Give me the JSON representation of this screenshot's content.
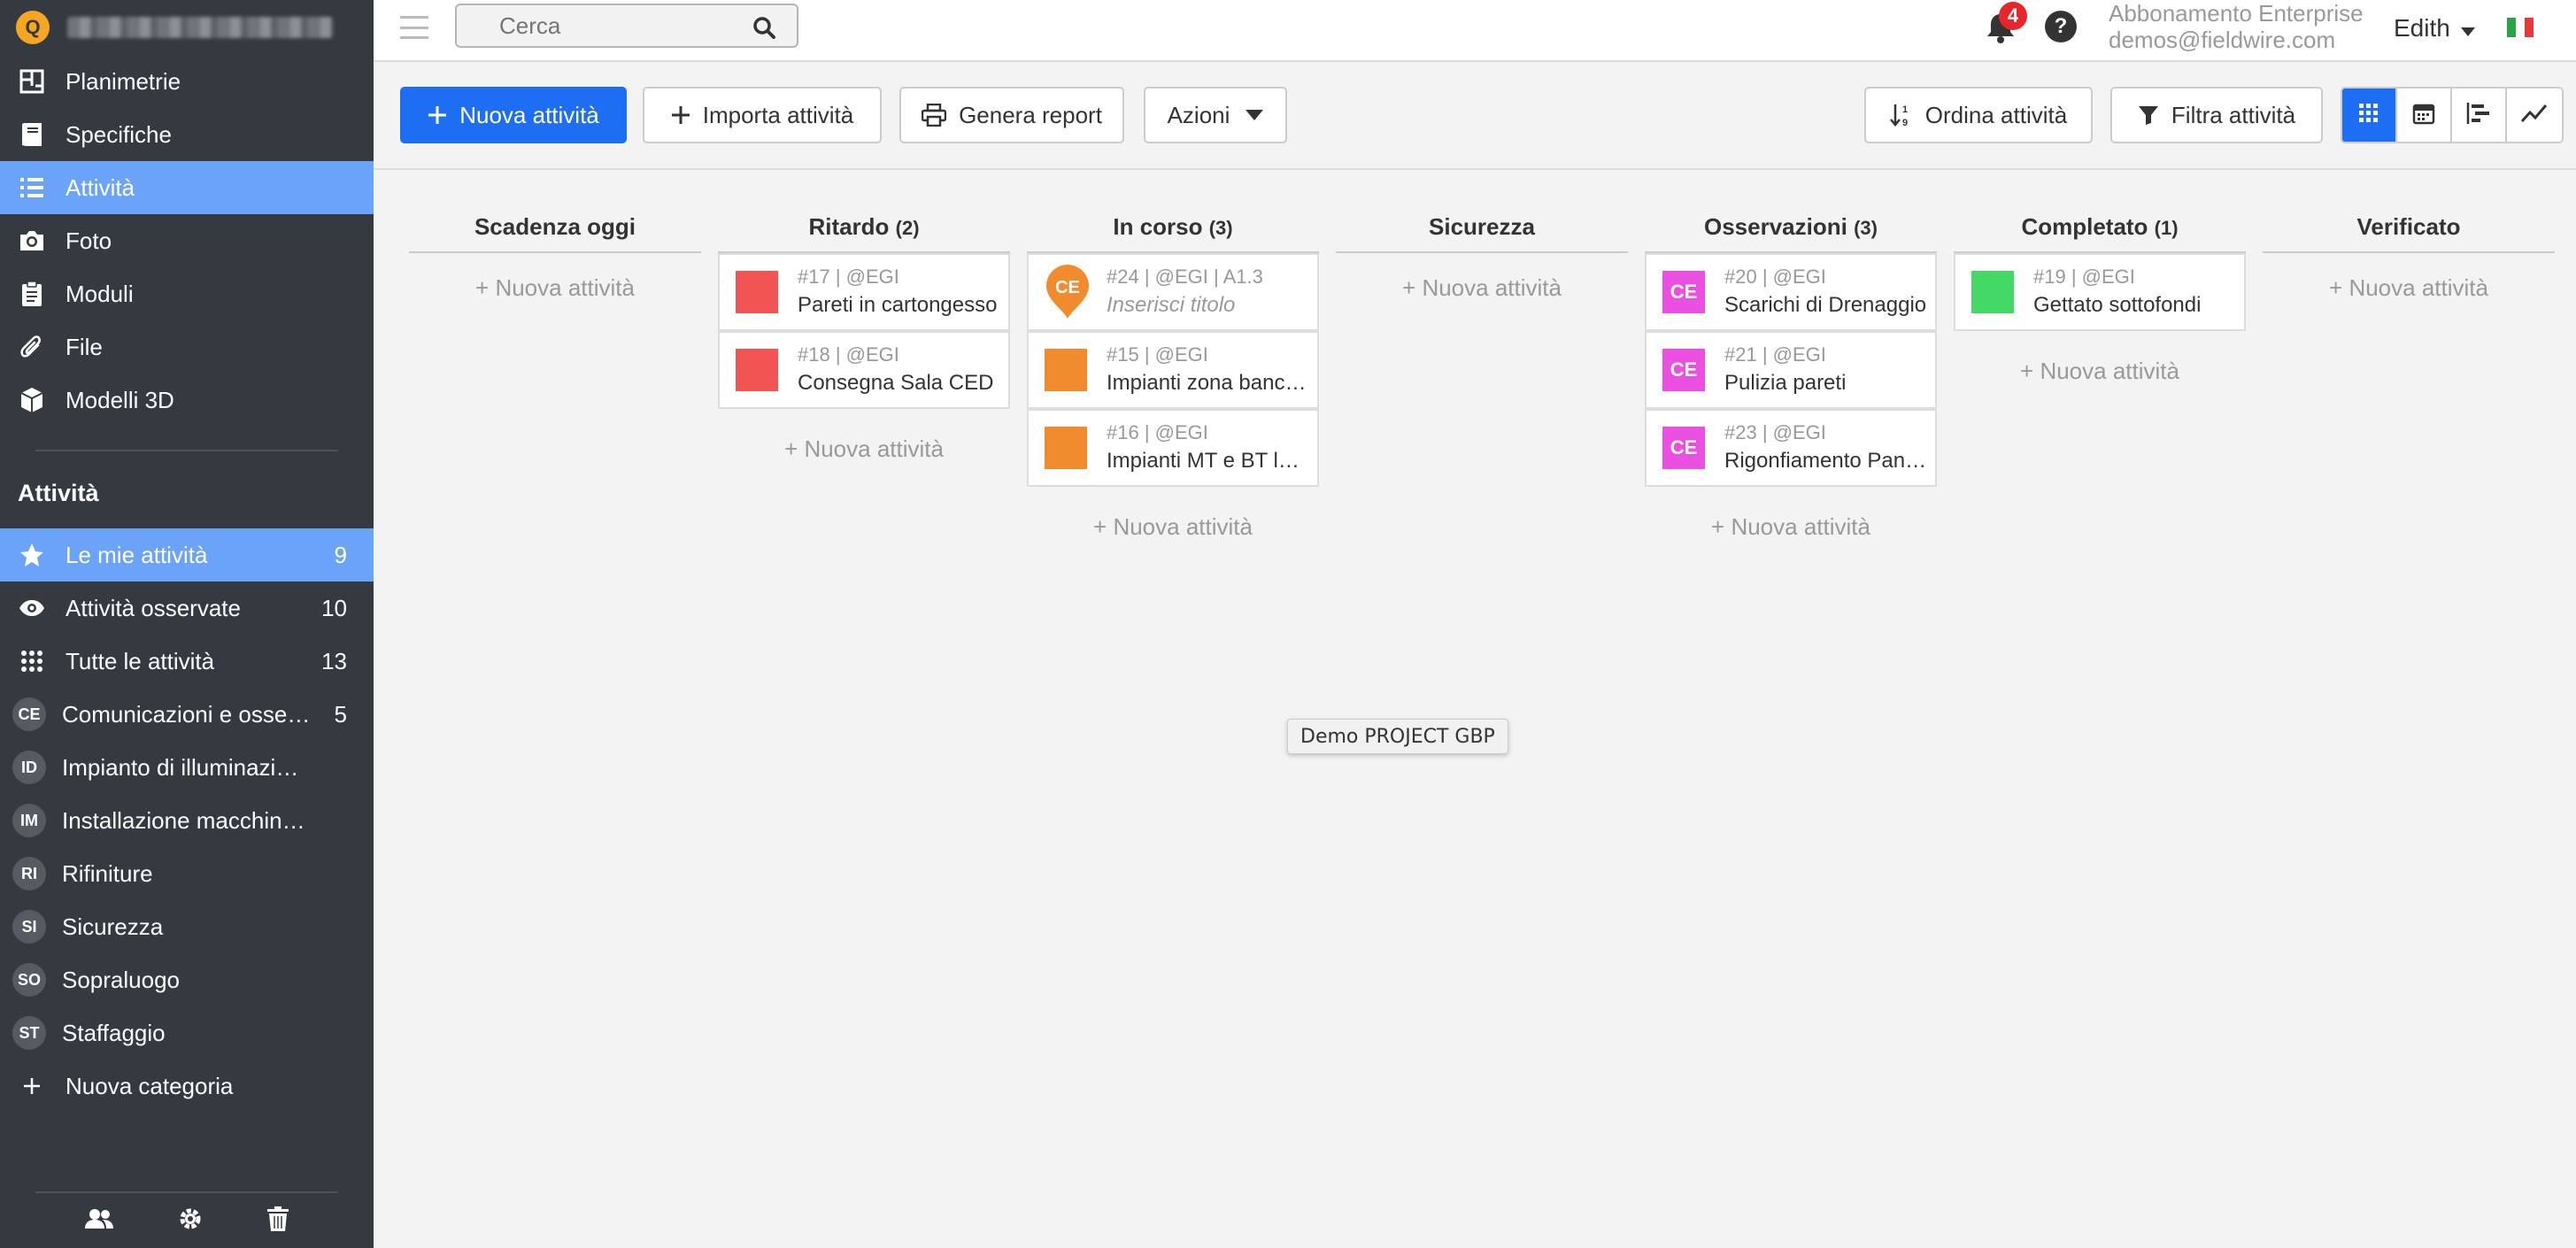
{
  "sidebar": {
    "logo_text": "Q",
    "nav": [
      {
        "label": "Planimetrie",
        "icon": "floorplan-icon"
      },
      {
        "label": "Specifiche",
        "icon": "book-icon"
      },
      {
        "label": "Attività",
        "icon": "list-icon",
        "active": true
      },
      {
        "label": "Foto",
        "icon": "camera-icon"
      },
      {
        "label": "Moduli",
        "icon": "clipboard-icon"
      },
      {
        "label": "File",
        "icon": "paperclip-icon"
      },
      {
        "label": "Modelli 3D",
        "icon": "cube-icon"
      }
    ],
    "section_title": "Attività",
    "filters": [
      {
        "label": "Le mie attività",
        "count": "9",
        "icon": "star-icon",
        "active": true
      },
      {
        "label": "Attività osservate",
        "count": "10",
        "icon": "eye-icon"
      },
      {
        "label": "Tutte le attività",
        "count": "13",
        "icon": "grid-icon"
      }
    ],
    "categories": [
      {
        "abbr": "CE",
        "label": "Comunicazioni e osse…",
        "count": "5"
      },
      {
        "abbr": "ID",
        "label": "Impianto di illuminazi…",
        "count": ""
      },
      {
        "abbr": "IM",
        "label": "Installazione macchin…",
        "count": ""
      },
      {
        "abbr": "RI",
        "label": "Rifiniture",
        "count": ""
      },
      {
        "abbr": "SI",
        "label": "Sicurezza",
        "count": ""
      },
      {
        "abbr": "SO",
        "label": "Sopraluogo",
        "count": ""
      },
      {
        "abbr": "ST",
        "label": "Staffaggio",
        "count": ""
      }
    ],
    "new_category": "Nuova categoria"
  },
  "topbar": {
    "search_placeholder": "Cerca",
    "notifications": "4",
    "help": "?",
    "plan": "Abbonamento Enterprise",
    "email": "demos@fieldwire.com",
    "user": "Edith"
  },
  "toolbar": {
    "new_task": "Nuova attività",
    "import": "Importa attività",
    "report": "Genera report",
    "actions": "Azioni",
    "sort": "Ordina attività",
    "filter": "Filtra attività"
  },
  "board": {
    "new_task_label": "+ Nuova attività",
    "columns": [
      {
        "title": "Scadenza oggi",
        "count": "",
        "cards": []
      },
      {
        "title": "Ritardo",
        "count": "(2)",
        "cards": [
          {
            "meta": "#17 | @EGI",
            "title": "Pareti in cartongesso",
            "color": "#f25353",
            "type": "square"
          },
          {
            "meta": "#18 | @EGI",
            "title": "Consegna Sala CED",
            "color": "#f25353",
            "type": "square"
          }
        ]
      },
      {
        "title": "In corso",
        "count": "(3)",
        "cards": [
          {
            "meta": "#24 | @EGI | A1.3",
            "title": "Inserisci titolo",
            "color": "#f08c2e",
            "type": "pin",
            "abbr": "CE"
          },
          {
            "meta": "#15 | @EGI",
            "title": "Impianti zona banc…",
            "color": "#f08c2e",
            "type": "square"
          },
          {
            "meta": "#16 | @EGI",
            "title": "Impianti MT e BT lo…",
            "color": "#f08c2e",
            "type": "square"
          }
        ]
      },
      {
        "title": "Sicurezza",
        "count": "",
        "cards": []
      },
      {
        "title": "Osservazioni",
        "count": "(3)",
        "cards": [
          {
            "meta": "#20 | @EGI",
            "title": "Scarichi di Drenaggio",
            "color": "#ea4fe2",
            "type": "ce",
            "abbr": "CE"
          },
          {
            "meta": "#21 | @EGI",
            "title": "Pulizia pareti",
            "color": "#ea4fe2",
            "type": "ce",
            "abbr": "CE"
          },
          {
            "meta": "#23 | @EGI",
            "title": "Rigonfiamento Pan…",
            "color": "#ea4fe2",
            "type": "ce",
            "abbr": "CE"
          }
        ]
      },
      {
        "title": "Completato",
        "count": "(1)",
        "cards": [
          {
            "meta": "#19 | @EGI",
            "title": "Gettato sottofondi",
            "color": "#43d964",
            "type": "square"
          }
        ]
      },
      {
        "title": "Verificato",
        "count": "",
        "cards": []
      }
    ]
  },
  "tooltip": "Demo PROJECT GBP",
  "colors": {
    "accent": "#1d6ef2",
    "sidebar": "#343a40",
    "sidebar_active": "#6aa3f7"
  }
}
